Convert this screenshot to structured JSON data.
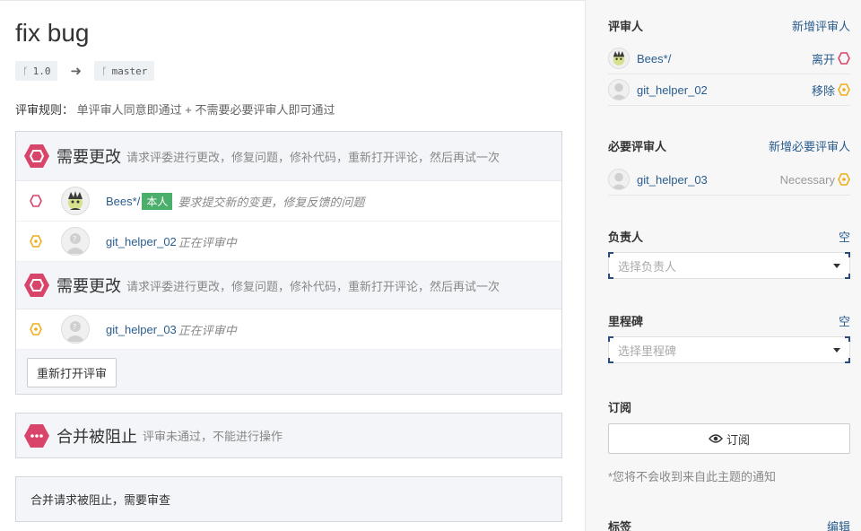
{
  "pr": {
    "title": "fix bug",
    "source_branch": "1.0",
    "target_branch": "master",
    "rules_label": "评审规则：",
    "rules_value": "单评审人同意即通过 + 不需要必要评审人即可通过"
  },
  "review": {
    "groups": [
      {
        "title": "需要更改",
        "desc": "请求评委进行更改，修复问题，修补代码，重新打开评论，然后再试一次",
        "rows": [
          {
            "name": "Bees*/",
            "badge": "本人",
            "note": "要求提交新的变更，修复反馈的问题",
            "status": "changes-requested"
          },
          {
            "name": "git_helper_02",
            "badge": "",
            "note": "正在评审中",
            "status": "pending"
          }
        ]
      },
      {
        "title": "需要更改",
        "desc": "请求评委进行更改，修复问题，修补代码，重新打开评论，然后再试一次",
        "rows": [
          {
            "name": "git_helper_03",
            "badge": "",
            "note": "正在评审中",
            "status": "pending"
          }
        ]
      }
    ],
    "reopen_label": "重新打开评审"
  },
  "merge": {
    "title": "合并被阻止",
    "desc": "评审未通过，不能进行操作",
    "notice": "合并请求被阻止，需要审查"
  },
  "sidebar": {
    "reviewers": {
      "title": "评审人",
      "add_label": "新增评审人",
      "items": [
        {
          "name": "Bees*/",
          "action": "离开"
        },
        {
          "name": "git_helper_02",
          "action": "移除"
        }
      ]
    },
    "required": {
      "title": "必要评审人",
      "add_label": "新增必要评审人",
      "items": [
        {
          "name": "git_helper_03",
          "action": "Necessary"
        }
      ]
    },
    "assignee": {
      "title": "负责人",
      "empty_label": "空",
      "placeholder": "选择负责人"
    },
    "milestone": {
      "title": "里程碑",
      "empty_label": "空",
      "placeholder": "选择里程碑"
    },
    "subscribe": {
      "title": "订阅",
      "button_label": "订阅",
      "note": "*您将不会收到来自此主题的通知"
    },
    "labels": {
      "title": "标签",
      "edit_label": "编辑"
    }
  },
  "colors": {
    "changes": "#d9456a",
    "pending": "#f0ad1c",
    "link": "#2a5d8f",
    "badge": "#4cae6b"
  }
}
